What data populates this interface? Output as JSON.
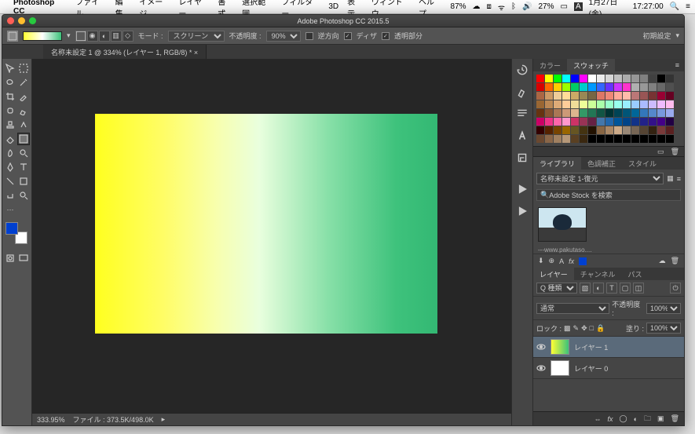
{
  "menubar": {
    "app": "Photoshop CC",
    "items": [
      "ファイル",
      "編集",
      "イメージ",
      "レイヤー",
      "書式",
      "選択範囲",
      "フィルター",
      "3D",
      "表示",
      "ウィンドウ",
      "ヘルプ"
    ],
    "battery": "27%",
    "date": "1月27日(金)",
    "time": "17:27:00",
    "gpu": "87%"
  },
  "window": {
    "title": "Adobe Photoshop CC 2015.5"
  },
  "optbar": {
    "mode_label": "モード :",
    "mode_val": "スクリーン",
    "opacity_label": "不透明度 :",
    "opacity_val": "90%",
    "reverse": "逆方向",
    "dither": "ディザ",
    "transparency": "透明部分",
    "preset": "初期設定"
  },
  "tab": {
    "name": "名称未設定 1 @ 334% (レイヤー 1, RGB/8) *"
  },
  "status": {
    "zoom": "333.95%",
    "file": "ファイル : 373.5K/498.0K"
  },
  "panels": {
    "color_tab": "カラー",
    "swatch_tab": "スウォッチ",
    "lib_tab": "ライブラリ",
    "tone_tab": "色調補正",
    "style_tab": "スタイル",
    "lib_select": "名称未設定 1-復元",
    "search_ph": "Adobe Stock を検索",
    "thumb_caption": "---www.pakutaso....",
    "layers_tab": "レイヤー",
    "channels_tab": "チャンネル",
    "paths_tab": "パス",
    "kind": "Q 種類",
    "blend": "通常",
    "op_label": "不透明度 :",
    "op_val": "100%",
    "lock_label": "ロック :",
    "fill_label": "塗り :",
    "fill_val": "100%",
    "layer1": "レイヤー 1",
    "layer0": "レイヤー 0"
  },
  "swatch_rows": [
    [
      "#ff0000",
      "#ffff00",
      "#00ff00",
      "#00ffff",
      "#0000ff",
      "#ff00ff",
      "#ffffff",
      "#ebebeb",
      "#d6d6d6",
      "#c0c0c0",
      "#ababab",
      "#969696",
      "#808080",
      "#404040",
      "#000000",
      "#333333"
    ],
    [
      "#d80000",
      "#ff6600",
      "#ffcc00",
      "#99ff00",
      "#00cc66",
      "#00cccc",
      "#0099ff",
      "#3366ff",
      "#6633ff",
      "#cc33ff",
      "#ff33cc",
      "#b0b0b0",
      "#989898",
      "#808080",
      "#686868",
      "#505050"
    ],
    [
      "#aa6644",
      "#cc9966",
      "#eecc99",
      "#ffdd99",
      "#ccaa66",
      "#998855",
      "#776644",
      "#dd7766",
      "#ee8877",
      "#ffaa99",
      "#ffbbaa",
      "#bb7777",
      "#995555",
      "#773333",
      "#990033",
      "#660022"
    ],
    [
      "#996633",
      "#bb8855",
      "#ddaa77",
      "#ffcc99",
      "#f0dd99",
      "#eeff99",
      "#ccff99",
      "#aaffaa",
      "#99ffcc",
      "#99ffee",
      "#99eeff",
      "#99ccff",
      "#aabbff",
      "#ccbbff",
      "#eebbff",
      "#ffbbee"
    ],
    [
      "#663311",
      "#885533",
      "#aa7755",
      "#cc9977",
      "#dcb68e",
      "#339966",
      "#227755",
      "#115544",
      "#003333",
      "#004455",
      "#005577",
      "#006699",
      "#3377bb",
      "#5588cc",
      "#7799dd",
      "#99aaee"
    ],
    [
      "#cc0066",
      "#ee3388",
      "#ff66aa",
      "#ff99cc",
      "#cc3366",
      "#993355",
      "#662244",
      "#4477aa",
      "#2266aa",
      "#005599",
      "#004488",
      "#113388",
      "#222288",
      "#331188",
      "#440088",
      "#220044"
    ],
    [
      "#330000",
      "#552200",
      "#774400",
      "#996600",
      "#665522",
      "#443311",
      "#221100",
      "#886644",
      "#aa8866",
      "#ccaa88",
      "#998877",
      "#776655",
      "#554433",
      "#332211",
      "#7a3a3a",
      "#5a2020"
    ],
    [
      "#6a4830",
      "#8a6648",
      "#a08060",
      "#b69878",
      "#5a4022",
      "#3a2810",
      "#000000",
      "#000000",
      "#000000",
      "#000000",
      "#000000",
      "#000000",
      "#000000",
      "#000000",
      "#000000",
      "#000000"
    ]
  ]
}
